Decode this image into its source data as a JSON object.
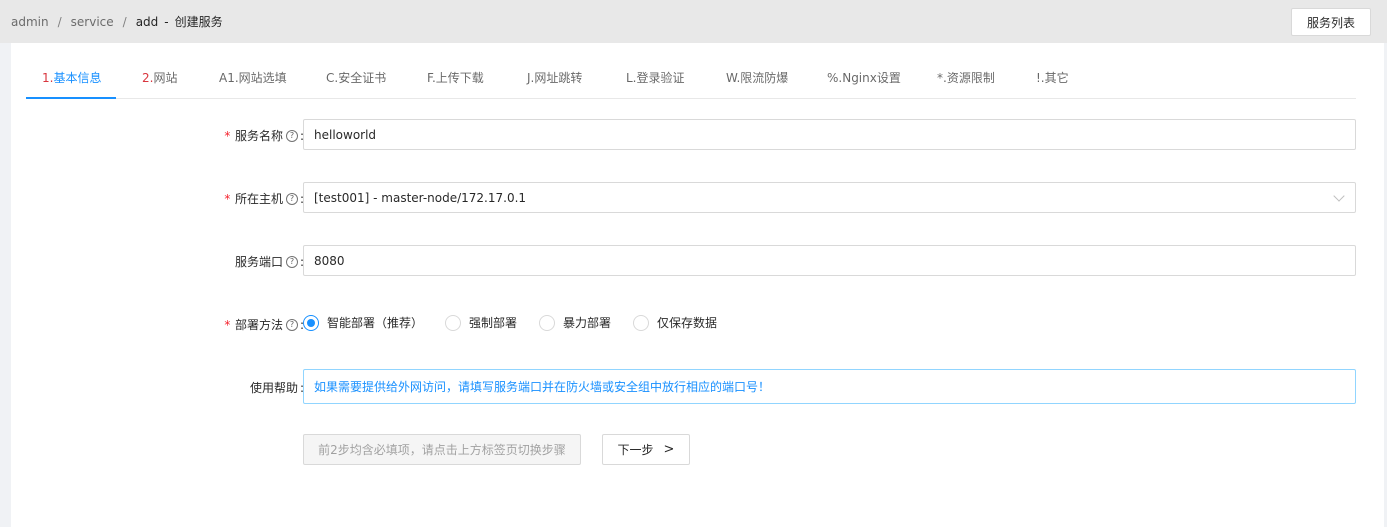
{
  "breadcrumb": [
    "admin",
    "service",
    "add"
  ],
  "page_title": "创建服务",
  "title_sep": "-",
  "breadcrumb_sep": "/",
  "header": {
    "list_button": "服务列表"
  },
  "tabs": [
    {
      "num": "1.",
      "label": "基本信息"
    },
    {
      "num": "2.",
      "label": "网站"
    },
    {
      "num": "",
      "label": "A1.网站选填"
    },
    {
      "num": "",
      "label": "C.安全证书"
    },
    {
      "num": "",
      "label": "F.上传下载"
    },
    {
      "num": "",
      "label": "J.网址跳转"
    },
    {
      "num": "",
      "label": "L.登录验证"
    },
    {
      "num": "",
      "label": "W.限流防爆"
    },
    {
      "num": "",
      "label": "%.Nginx设置"
    },
    {
      "num": "",
      "label": "*.资源限制"
    },
    {
      "num": "",
      "label": "!.其它"
    }
  ],
  "form": {
    "name": {
      "label": "服务名称",
      "value": "helloworld"
    },
    "host": {
      "label": "所在主机",
      "value": "[test001] - master-node/172.17.0.1"
    },
    "port": {
      "label": "服务端口",
      "value": "8080"
    },
    "deploy": {
      "label": "部署方法",
      "options": [
        "智能部署（推荐）",
        "强制部署",
        "暴力部署",
        "仅保存数据"
      ],
      "selected": "智能部署（推荐）"
    },
    "help": {
      "label": "使用帮助",
      "text": "如果需要提供给外网访问，请填写服务端口并在防火墙或安全组中放行相应的端口号！"
    }
  },
  "buttons": {
    "prev_disabled": "前2步均含必填项，请点击上方标签页切换步骤",
    "next": "下一步"
  },
  "symbols": {
    "required": "*",
    "question": "?",
    "colon": ":",
    "next_arrow": ">"
  },
  "colors": {
    "accent": "#1890ff",
    "required": "#f5222d",
    "tab_number": "#d9363e"
  }
}
